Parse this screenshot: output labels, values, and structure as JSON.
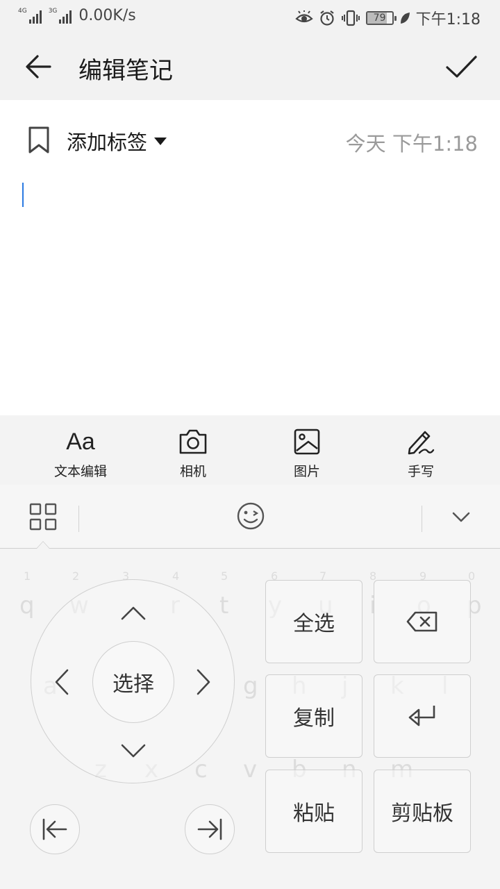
{
  "status_bar": {
    "signal1_tag": "4G",
    "signal2_tag": "3G",
    "net_speed": "0.00K/s",
    "battery_level": "79",
    "battery_fraction": 0.79,
    "time": "下午1:18"
  },
  "header": {
    "title": "编辑笔记"
  },
  "note": {
    "tag_label": "添加标签",
    "time": "今天 下午1:18",
    "body": ""
  },
  "toolbar": {
    "items": [
      {
        "label": "文本编辑",
        "icon": "text-format-icon",
        "glyph": "Aa"
      },
      {
        "label": "相机",
        "icon": "camera-icon"
      },
      {
        "label": "图片",
        "icon": "image-icon"
      },
      {
        "label": "手写",
        "icon": "handwriting-icon"
      }
    ]
  },
  "keyboard": {
    "dpad_center": "选择",
    "keys": {
      "select_all": "全选",
      "copy": "复制",
      "paste": "粘贴",
      "clipboard": "剪贴板"
    }
  }
}
